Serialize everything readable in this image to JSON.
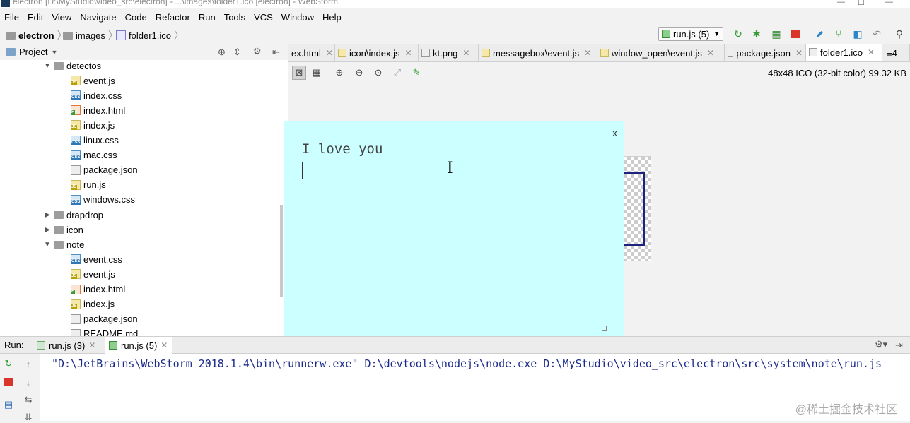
{
  "window": {
    "title": "electron [D:\\MyStudio\\video_src\\electron] - ...\\images\\folder1.ico [electron] - WebStorm"
  },
  "menu": [
    "File",
    "Edit",
    "View",
    "Navigate",
    "Code",
    "Refactor",
    "Run",
    "Tools",
    "VCS",
    "Window",
    "Help"
  ],
  "breadcrumb": [
    "electron",
    "images",
    "folder1.ico"
  ],
  "toolbar": {
    "run_config": "run.js (5)",
    "icons": [
      "rerun-icon",
      "debug-icon",
      "coverage-icon",
      "stop-icon",
      "vcs-update-icon",
      "vcs-commit-icon",
      "vcs-compare-icon",
      "revert-icon",
      "search-icon"
    ]
  },
  "project_panel": {
    "title": "Project",
    "tree": [
      {
        "label": "detectos",
        "type": "dir",
        "expanded": true
      },
      {
        "label": "event.js",
        "type": "js"
      },
      {
        "label": "index.css",
        "type": "css"
      },
      {
        "label": "index.html",
        "type": "html"
      },
      {
        "label": "index.js",
        "type": "js"
      },
      {
        "label": "linux.css",
        "type": "css"
      },
      {
        "label": "mac.css",
        "type": "css"
      },
      {
        "label": "package.json",
        "type": "json"
      },
      {
        "label": "run.js",
        "type": "js"
      },
      {
        "label": "windows.css",
        "type": "css"
      },
      {
        "label": "drapdrop",
        "type": "dir",
        "expanded": false
      },
      {
        "label": "icon",
        "type": "dir",
        "expanded": false
      },
      {
        "label": "note",
        "type": "dir",
        "expanded": true
      },
      {
        "label": "event.css",
        "type": "css"
      },
      {
        "label": "event.js",
        "type": "js"
      },
      {
        "label": "index.html",
        "type": "html"
      },
      {
        "label": "index.js",
        "type": "js"
      },
      {
        "label": "package.json",
        "type": "json"
      },
      {
        "label": "README.md",
        "type": "md"
      }
    ]
  },
  "editor_tabs": [
    {
      "label": "ex.html"
    },
    {
      "label": "icon\\index.js"
    },
    {
      "label": "kt.png"
    },
    {
      "label": "messagebox\\event.js"
    },
    {
      "label": "window_open\\event.js"
    },
    {
      "label": "package.json"
    },
    {
      "label": "folder1.ico",
      "active": true
    },
    {
      "label": "≡4"
    }
  ],
  "image_viewer": {
    "info": "48x48 ICO (32-bit color) 99.32 KB"
  },
  "popup": {
    "close_label": "x",
    "text": "I love you",
    "background": "#ccffff"
  },
  "run_panel": {
    "label": "Run:",
    "tabs": [
      {
        "label": "run.js (3)",
        "active": false
      },
      {
        "label": "run.js (5)",
        "active": true
      }
    ],
    "output": "\"D:\\JetBrains\\WebStorm 2018.1.4\\bin\\runnerw.exe\" D:\\devtools\\nodejs\\node.exe D:\\MyStudio\\video_src\\electron\\src\\system\\note\\run.js"
  },
  "watermark": "@稀土掘金技术社区"
}
